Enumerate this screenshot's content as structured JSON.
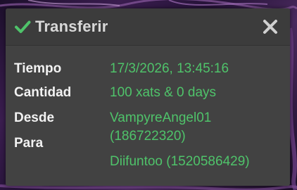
{
  "dialog": {
    "title": "Transferir",
    "icons": {
      "status": "check-icon",
      "close": "close-icon"
    },
    "colors": {
      "accent": "#4fc36a",
      "background": "#424242",
      "header": "#3c3c3c"
    }
  },
  "fields": {
    "time_label": "Tiempo",
    "time_value": "17/3/2026, 13:45:16",
    "amount_label": "Cantidad",
    "amount_value": "100 xats & 0 days",
    "from_label": "Desde",
    "from_value_line1": "VampyreAngel01",
    "from_value_line2": "(186722320)",
    "to_label": "Para",
    "to_value": "Diifuntoo (1520586429)"
  }
}
